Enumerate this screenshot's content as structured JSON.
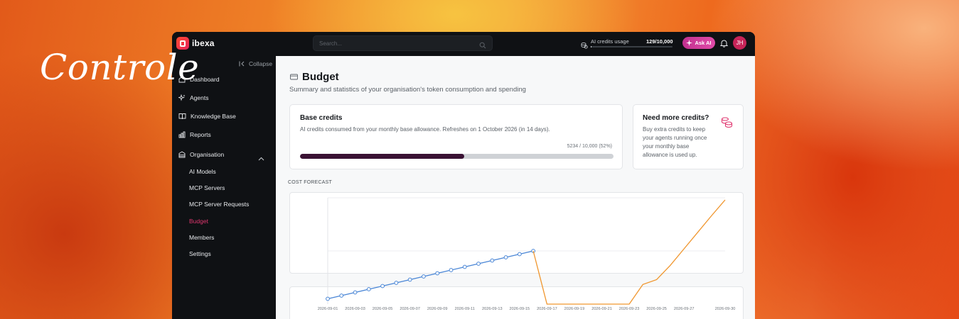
{
  "hero": {
    "title": "Controle"
  },
  "topbar": {
    "logo_text": "ibexa",
    "search_placeholder": "Search...",
    "credits_label": "AI credits usage",
    "credits_value": "129/10,000",
    "credits_fraction": 0.0129,
    "ask_ai_label": "Ask AI",
    "avatar_initials": "JH"
  },
  "sidebar": {
    "collapse_label": "Collapse",
    "items": [
      {
        "label": "Dashboard",
        "icon": "home-icon"
      },
      {
        "label": "Agents",
        "icon": "sparkles-icon"
      },
      {
        "label": "Knowledge Base",
        "icon": "book-icon"
      },
      {
        "label": "Reports",
        "icon": "bar-chart-icon"
      },
      {
        "label": "Organisation",
        "icon": "building-icon"
      }
    ],
    "sub_items": [
      {
        "label": "AI Models",
        "active": false
      },
      {
        "label": "MCP Servers",
        "active": false
      },
      {
        "label": "MCP Server Requests",
        "active": false
      },
      {
        "label": "Budget",
        "active": true
      },
      {
        "label": "Members",
        "active": false
      },
      {
        "label": "Settings",
        "active": false
      }
    ]
  },
  "page": {
    "title": "Budget",
    "subtitle": "Summary and statistics of your organisation's token consumption and spending"
  },
  "base_credits": {
    "title": "Base credits",
    "description": "AI credits consumed from your monthly base allowance. Refreshes on 1 October 2026 (in 14 days).",
    "progress_text": "5234 / 10,000 (52%)",
    "used": 5234,
    "total": 10000
  },
  "more_credits": {
    "title": "Need more credits?",
    "description_lines": [
      "Buy extra credits to keep",
      "your agents running once",
      "your monthly base",
      "allowance is used up."
    ]
  },
  "forecast": {
    "label": "COST FORECAST"
  },
  "colors": {
    "accent": "#e0366f",
    "actual_series": "#4a86d6",
    "forecast_series": "#f0962e",
    "progress_fill": "#3a1233"
  },
  "chart_data": {
    "type": "line",
    "x_tick_labels": [
      "2026-09-01",
      "2026-09-03",
      "2026-09-05",
      "2026-09-07",
      "2026-09-09",
      "2026-09-11",
      "2026-09-13",
      "2026-09-15",
      "2026-09-17",
      "2026-09-19",
      "2026-09-21",
      "2026-09-23",
      "2026-09-25",
      "2026-09-27",
      "2026-09-30"
    ],
    "series": [
      {
        "style": "markers",
        "color": "#4a86d6",
        "points": [
          [
            "2026-09-01",
            1.0
          ],
          [
            "2026-09-02",
            1.6
          ],
          [
            "2026-09-03",
            2.2
          ],
          [
            "2026-09-04",
            2.8
          ],
          [
            "2026-09-05",
            3.4
          ],
          [
            "2026-09-06",
            4.0
          ],
          [
            "2026-09-07",
            4.6
          ],
          [
            "2026-09-08",
            5.2
          ],
          [
            "2026-09-09",
            5.8
          ],
          [
            "2026-09-10",
            6.4
          ],
          [
            "2026-09-11",
            7.0
          ],
          [
            "2026-09-12",
            7.6
          ],
          [
            "2026-09-13",
            8.2
          ],
          [
            "2026-09-14",
            8.8
          ],
          [
            "2026-09-15",
            9.4
          ],
          [
            "2026-09-16",
            10.0
          ]
        ]
      },
      {
        "style": "line",
        "color": "#f0962e",
        "points": [
          [
            "2026-09-16",
            10.0
          ],
          [
            "2026-09-17",
            0.0
          ],
          [
            "2026-09-18",
            0.0
          ],
          [
            "2026-09-19",
            0.0
          ],
          [
            "2026-09-20",
            0.0
          ],
          [
            "2026-09-21",
            0.0
          ],
          [
            "2026-09-22",
            0.0
          ],
          [
            "2026-09-23",
            0.0
          ],
          [
            "2026-09-24",
            3.7
          ],
          [
            "2026-09-25",
            4.6
          ],
          [
            "2026-09-26",
            7.3
          ],
          [
            "2026-09-27",
            10.4
          ],
          [
            "2026-09-28",
            13.5
          ],
          [
            "2026-09-29",
            16.6
          ],
          [
            "2026-09-30",
            19.6
          ]
        ]
      }
    ],
    "ylim": [
      0,
      20
    ],
    "grid": true
  }
}
